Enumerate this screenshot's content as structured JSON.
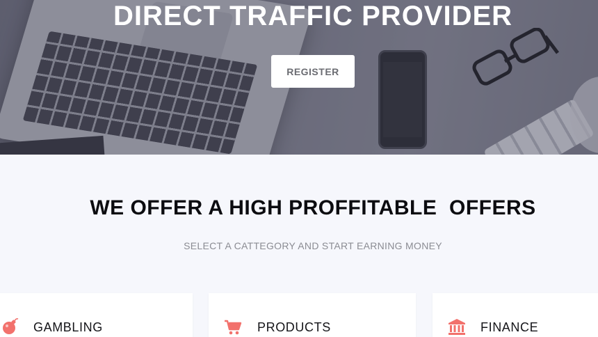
{
  "hero": {
    "title": "DIRECT TRAFFIC PROVIDER",
    "register_label": "REGISTER"
  },
  "offers": {
    "title": "WE OFFER A HIGH PROFFITABLE  OFFERS",
    "subtitle": "SELECT A CATTEGORY AND START EARNING MONEY",
    "categories": [
      {
        "label": "GAMBLING",
        "icon": "bomb-icon"
      },
      {
        "label": "PRODUCTS",
        "icon": "shopping-cart-icon"
      },
      {
        "label": "FINANCE",
        "icon": "bank-icon"
      }
    ]
  },
  "colors": {
    "accent": "#f2716c",
    "section_bg": "#f6f7fc",
    "hero_overlay": "#464860"
  }
}
